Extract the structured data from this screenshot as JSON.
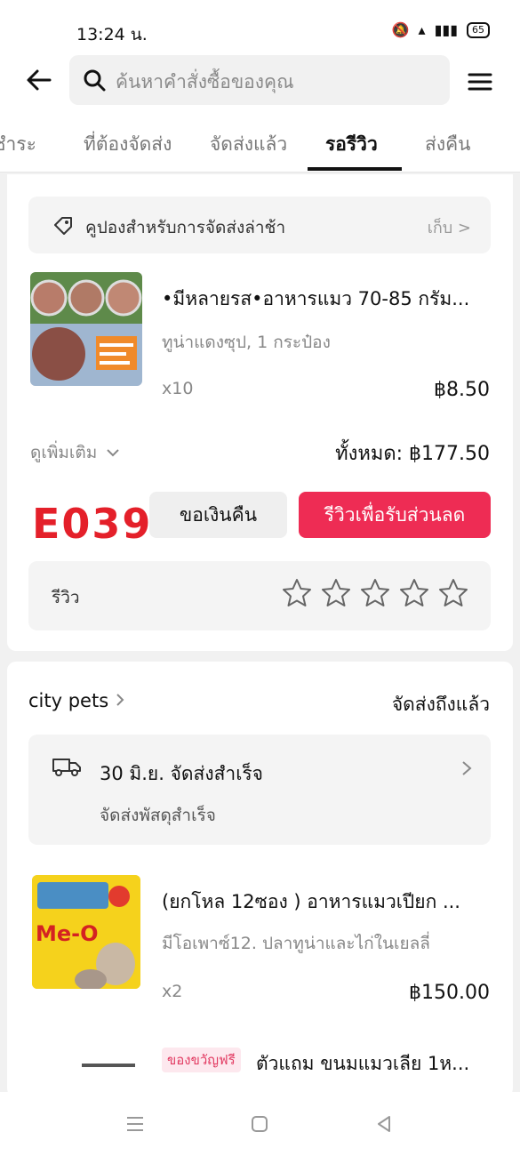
{
  "status_bar": {
    "time": "13:24 น.",
    "battery": "65"
  },
  "search": {
    "placeholder": "ค้นหาคำสั่งซื้อของคุณ"
  },
  "tabs": [
    {
      "label": "งชำระ"
    },
    {
      "label": "ที่ต้องจัดส่ง"
    },
    {
      "label": "จัดส่งแล้ว"
    },
    {
      "label": "รอรีวิว"
    },
    {
      "label": "ส่งคืน"
    }
  ],
  "coupon": {
    "label": "คูปองสำหรับการจัดส่งล่าช้า",
    "action": "เก็บ >"
  },
  "order1": {
    "title": "•มีหลายรส•อาหารแมว 70-85 กรัม...",
    "variant": "ทูน่าแดงซุป, 1 กระป๋อง",
    "qty": "x10",
    "price": "฿8.50",
    "see_more": "ดูเพิ่มเติม",
    "total": "ทั้งหมด: ฿177.50",
    "refund_button": "ขอเงินคืน",
    "review_button": "รีวิวเพื่อรับส่วนลด",
    "rating_label": "รีวิว",
    "rating_value": 0,
    "watermark": "E039"
  },
  "order2": {
    "shop_name": "city pets",
    "status": "จัดส่งถึงแล้ว",
    "delivery_title": "30 มิ.ย. จัดส่งสำเร็จ",
    "delivery_subtitle": "จัดส่งพัสดุสำเร็จ",
    "product_title": "(ยกโหล 12ซอง ) อาหารแมวเปียก ...",
    "product_variant": "มีโอเพาซ์12. ปลาทูน่าและไก่ในเยลลี่",
    "qty": "x2",
    "price": "฿150.00",
    "gift_badge": "ของขวัญฟรี",
    "gift_title": "ตัวแถม ขนมแมวเลีย 1ห..."
  },
  "colors": {
    "accent": "#ee2c54",
    "watermark": "#e4202a"
  }
}
